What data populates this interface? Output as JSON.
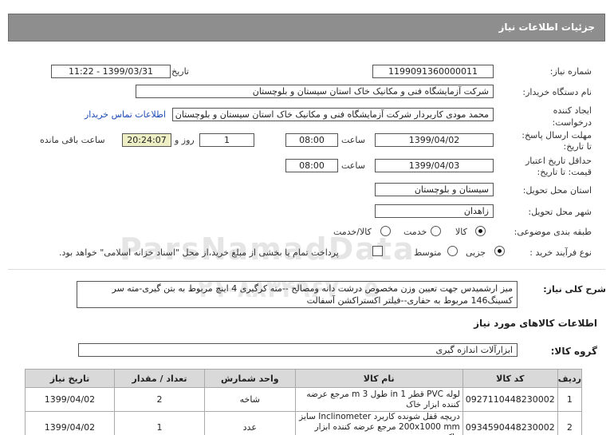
{
  "header": {
    "title": "جزئیات اطلاعات نیاز"
  },
  "fields": {
    "need_number_label": "شماره نیاز:",
    "need_number": "1199091360000011",
    "announce_label": "تاریخ و ساعت اعلان عمومی:",
    "announce_value": "1399/03/31 - 11:22",
    "buyer_label": "نام دستگاه خریدار:",
    "buyer_value": "شرکت آزمایشگاه فنی و مکانیک خاک استان سیستان و بلوچستان",
    "creator_label": "ایجاد کننده درخواست:",
    "creator_value": "محمد مودی کاربردار شرکت آزمایشگاه فنی و مکانیک خاک استان سیستان و بلوچستان",
    "contact_link": "اطلاعات تماس خریدار",
    "deadline_label": "مهلت ارسال پاسخ: تا تاریخ:",
    "deadline_date": "1399/04/02",
    "time_label": "ساعت",
    "deadline_time": "08:00",
    "days_value": "1",
    "days_label": "روز و",
    "remaining_time": "20:24:07",
    "remaining_label": "ساعت باقی مانده",
    "validity_label": "حداقل تاریخ اعتبار قیمت: تا تاریخ:",
    "validity_date": "1399/04/03",
    "validity_time": "08:00",
    "province_label": "استان محل تحویل:",
    "province_value": "سیستان و بلوچستان",
    "city_label": "شهر محل تحویل:",
    "city_value": "زاهدان",
    "category_label": "طبقه بندی موضوعی:",
    "cat_goods": "کالا",
    "cat_service": "خدمت",
    "cat_goods_service": "کالا/خدمت",
    "process_label": "نوع فرآیند خرید :",
    "proc_partial": "جزیی",
    "proc_medium": "متوسط",
    "payment_note": "پرداخت تمام یا بخشی از مبلغ خرید،از محل \"اسناد خزانه اسلامی\" خواهد بود."
  },
  "watermark": {
    "line1": "ParsNamadData",
    "line2": "۰۲۱-۸۸۳۴۹۶۷۰-۵"
  },
  "description": {
    "label": "شرح کلی نیاز:",
    "text": "میز ارشمیدس جهت تعیین وزن مخصوص درشت دانه ومصالح --مته کرگیری 4 اینچ مربوط به بتن گیری-مته سر کسینگ146 مربوط به حفاری--فیلتر اکستراکشن آسفالت"
  },
  "goods_section": {
    "title": "اطلاعات کالاهای مورد نیاز",
    "group_label": "گروه کالا:",
    "group_value": "ابزارآلات اندازه گیری"
  },
  "table": {
    "headers": [
      "ردیف",
      "کد کالا",
      "نام کالا",
      "واحد شمارش",
      "تعداد / مقدار",
      "تاریخ نیاز"
    ],
    "rows": [
      {
        "idx": "1",
        "code": "0927110448230002",
        "name": "لوله PVC قطر in 1 طول m 3 مرجع عرضه کننده ابزار خاک",
        "unit": "شاخه",
        "qty": "2",
        "date": "1399/04/02"
      },
      {
        "idx": "2",
        "code": "0934590448230002",
        "name": "دریچه قفل شونده کاربرد Inclinometer سایز 200x1000 mm مرجع عرضه کننده ابزار خاک",
        "unit": "عدد",
        "qty": "1",
        "date": "1399/04/02"
      }
    ]
  }
}
